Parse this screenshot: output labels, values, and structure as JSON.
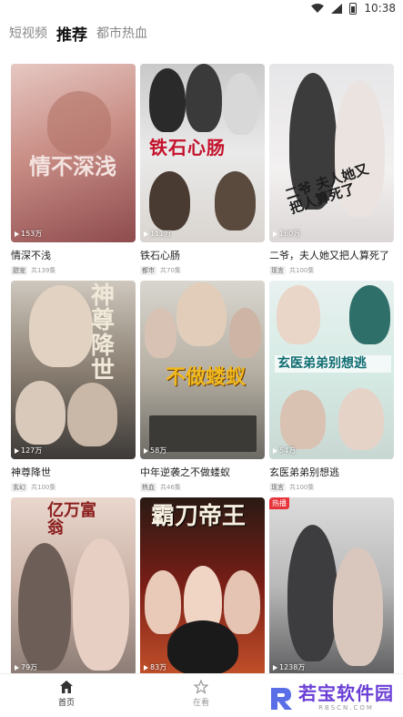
{
  "status_bar": {
    "time": "10:38"
  },
  "top_tabs": [
    {
      "label": "短视频",
      "active": false
    },
    {
      "label": "推荐",
      "active": true
    },
    {
      "label": "都市热血",
      "active": false
    }
  ],
  "cards": [
    {
      "title": "情深不浅",
      "plays": "153万",
      "tag": "甜宠",
      "episodes": "共139集",
      "poster": "情不深浅"
    },
    {
      "title": "铁石心肠",
      "plays": "111万",
      "tag": "都市",
      "episodes": "共70集",
      "poster": "铁石心肠"
    },
    {
      "title": "二爷，夫人她又把人算死了",
      "plays": "160万",
      "tag": "现言",
      "episodes": "共100集",
      "poster": "二爷 夫人她又把人算死了"
    },
    {
      "title": "神尊降世",
      "plays": "127万",
      "tag": "玄幻",
      "episodes": "共100集",
      "poster": "神尊降世"
    },
    {
      "title": "中年逆袭之不做蝼蚁",
      "plays": "58万",
      "tag": "热血",
      "episodes": "共46集",
      "poster": "不做蝼蚁"
    },
    {
      "title": "玄医弟弟别想逃",
      "plays": "54万",
      "tag": "现言",
      "episodes": "共100集",
      "poster": "玄医弟弟别想逃"
    },
    {
      "title": "",
      "plays": "79万",
      "tag": "",
      "episodes": "",
      "poster": "亿万富翁"
    },
    {
      "title": "",
      "plays": "83万",
      "tag": "",
      "episodes": "",
      "poster": "霸刀帝王"
    },
    {
      "title": "",
      "plays": "1238万",
      "tag": "",
      "episodes": "",
      "poster": "",
      "badge": "热播"
    }
  ],
  "bottom_nav": [
    {
      "label": "首页",
      "icon": "home-icon",
      "active": true
    },
    {
      "label": "在看",
      "icon": "star-icon",
      "active": false
    }
  ],
  "watermark": {
    "text": "若宝软件园",
    "url": "RBSCN.COM"
  },
  "colors": {
    "accent": "#111111",
    "hot": "#e8323a",
    "watermark": "#6b3fd6"
  }
}
